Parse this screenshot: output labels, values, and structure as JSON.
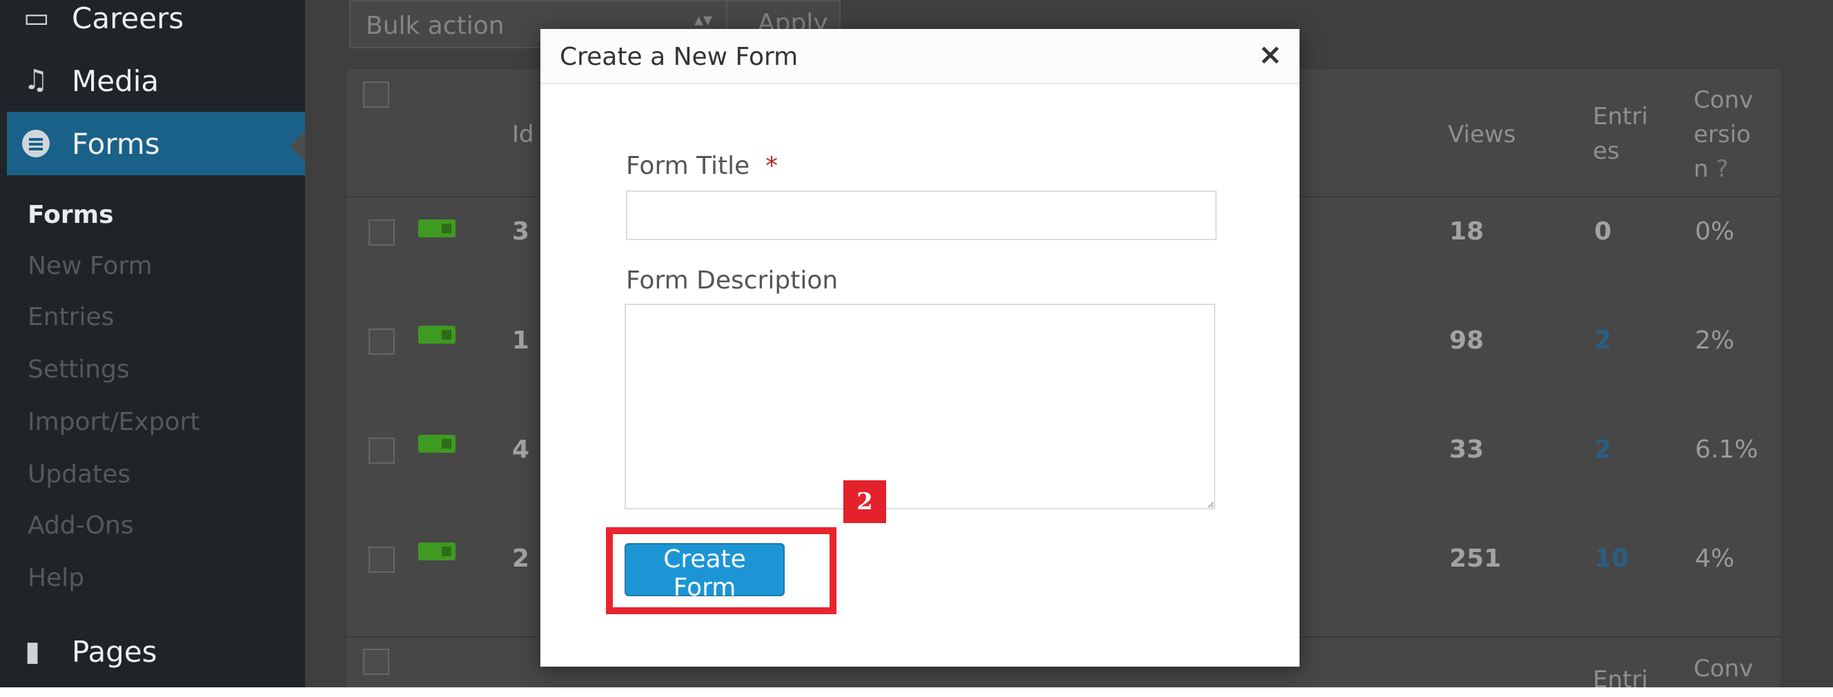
{
  "sidebar": {
    "top_items": [
      {
        "label": "Careers",
        "icon": "careers-icon"
      },
      {
        "label": "Media",
        "icon": "media-icon"
      },
      {
        "label": "Forms",
        "icon": "forms-icon",
        "active": true
      }
    ],
    "submenu": [
      "Forms",
      "New Form",
      "Entries",
      "Settings",
      "Import/Export",
      "Updates",
      "Add-Ons",
      "Help"
    ],
    "bottom_item": {
      "label": "Pages",
      "icon": "pages-icon"
    }
  },
  "toolbar": {
    "bulk_action": "Bulk action",
    "apply_label": "Apply"
  },
  "table": {
    "headers": {
      "id": "Id",
      "views": "Views",
      "entries": "Entri es",
      "conversion": "Conv ersio n"
    },
    "rows": [
      {
        "id": "3",
        "views": "18",
        "entries": "0",
        "conversion": "0%"
      },
      {
        "id": "1",
        "views": "98",
        "entries": "2",
        "conversion": "2%"
      },
      {
        "id": "4",
        "views": "33",
        "entries": "2",
        "conversion": "6.1%"
      },
      {
        "id": "2",
        "views": "251",
        "entries": "10",
        "conversion": "4%"
      }
    ],
    "footer_headers": {
      "entries": "Entri",
      "conversion": "Conv"
    }
  },
  "modal": {
    "title": "Create a New Form",
    "close_icon": "×",
    "title_label": "Form Title",
    "required_mark": "*",
    "title_value": "",
    "description_label": "Form Description",
    "description_value": "",
    "create_button": "Create Form"
  },
  "annotation": {
    "step": "2",
    "color": "#e8252f"
  }
}
